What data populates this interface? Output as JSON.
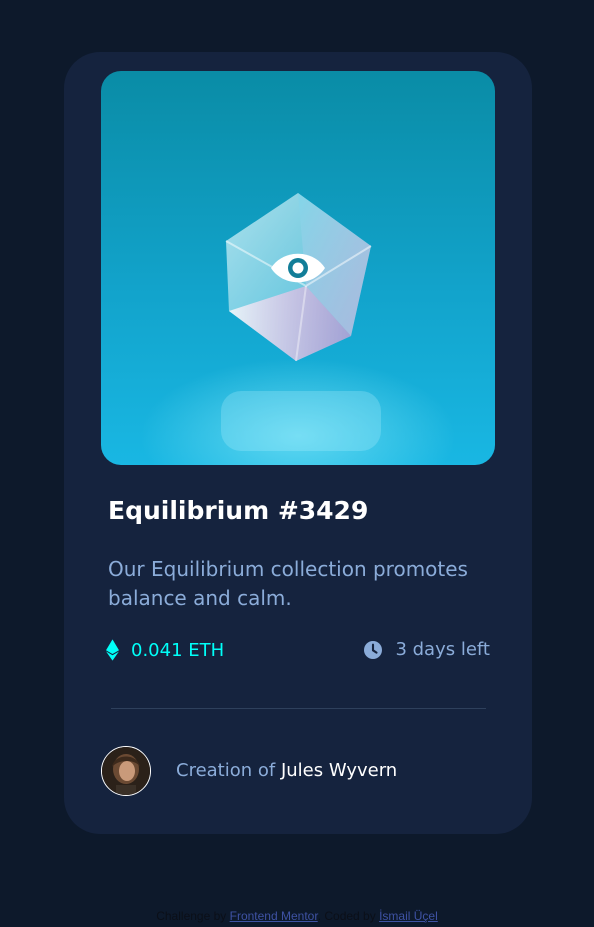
{
  "card": {
    "title": "Equilibrium #3429",
    "description": "Our Equilibrium collection promotes balance and calm.",
    "price": "0.041 ETH",
    "time_left": "3 days left",
    "creator_prefix": "Creation of",
    "creator_name": "Jules Wyvern"
  },
  "icons": {
    "overlay": "eye-icon",
    "price": "ethereum-icon",
    "time": "clock-icon"
  },
  "attribution": {
    "prefix": "Challenge by",
    "challenge_link": "Frontend Mentor",
    "middle": ". Coded by",
    "author_link": "İsmail Üçel"
  },
  "colors": {
    "page_background": "#0d192b",
    "card_background": "#15233e",
    "accent_cyan": "#00fff8",
    "soft_blue": "#8bacd9",
    "white": "#ffffff"
  }
}
